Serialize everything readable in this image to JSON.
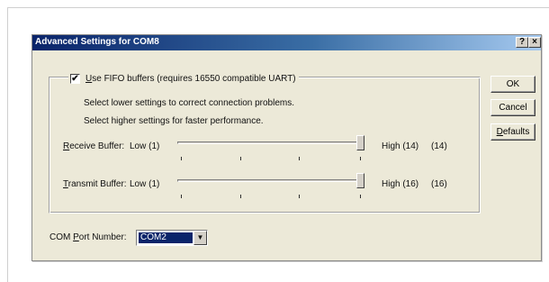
{
  "dialog": {
    "title": "Advanced Settings for COM8",
    "help_button": "?",
    "close_button": "×"
  },
  "fifo": {
    "checked": true,
    "check_mark": "✔",
    "label_prefix": "",
    "label_mnemonic": "U",
    "label_rest": "se FIFO buffers (requires 16550 compatible UART)"
  },
  "hints": {
    "line1": "Select lower settings to correct connection problems.",
    "line2": "Select higher settings for faster performance."
  },
  "receive": {
    "label_mnemonic": "R",
    "label_rest": "eceive Buffer:",
    "low": "Low (1)",
    "high": "High (14)",
    "value_display": "(14)",
    "value": 14,
    "min": 1,
    "max": 14
  },
  "transmit": {
    "label_mnemonic": "T",
    "label_rest": "ransmit Buffer:",
    "low": "Low (1)",
    "high": "High (16)",
    "value_display": "(16)",
    "value": 16,
    "min": 1,
    "max": 16
  },
  "buttons": {
    "ok": "OK",
    "cancel": "Cancel",
    "defaults_mnemonic": "D",
    "defaults_rest": "efaults"
  },
  "com_port": {
    "label_prefix": "COM ",
    "label_mnemonic": "P",
    "label_rest": "ort Number:",
    "selected": "COM2",
    "arrow_icon": "▼"
  }
}
